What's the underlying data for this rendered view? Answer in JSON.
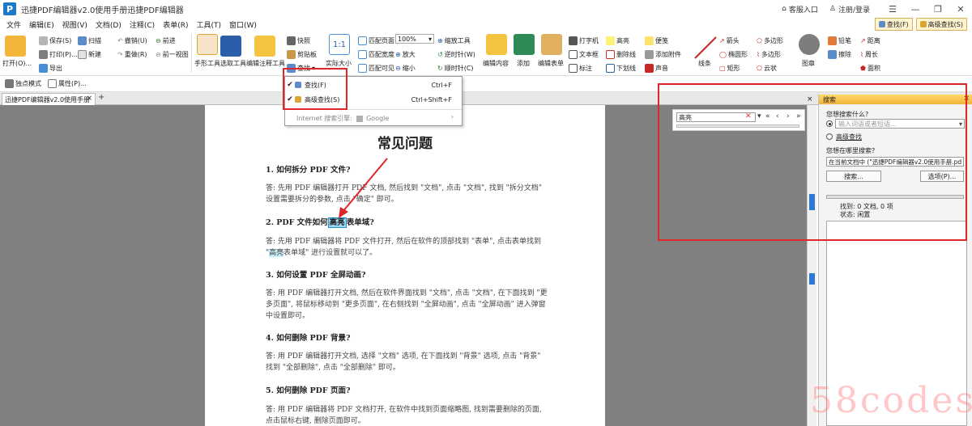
{
  "app": {
    "title": "迅捷PDF编辑器v2.0使用手册迅捷PDF编辑器",
    "logo": "P",
    "right_links": [
      {
        "icon": "home-icon",
        "label": "客服入口"
      },
      {
        "icon": "user-icon",
        "label": "注册/登录"
      }
    ],
    "window_buttons": [
      "☰",
      "—",
      "❐",
      "✕"
    ]
  },
  "menu": [
    "文件",
    "编辑(E)",
    "视图(V)",
    "文档(D)",
    "注释(C)",
    "表单(R)",
    "工具(T)",
    "窗口(W)"
  ],
  "quick_tools": [
    {
      "icon": "find-icon",
      "label": "查找(F)"
    },
    {
      "icon": "advanced-find-icon",
      "label": "高级查找(S)"
    }
  ],
  "ribbon": {
    "open": "打开(O)...",
    "save": "保存(S)",
    "print": "打印(P)...",
    "export": "导出",
    "scan": "扫描",
    "new": "新建",
    "undo": "撤销(U)",
    "redo": "重做(R)",
    "forward": "前进",
    "prev_view": "前一视图",
    "hand_tool": "手形工具",
    "select_tool": "选取工具",
    "annotation_tool": "编辑注释工具",
    "snapshot": "快照",
    "clipboard": "剪贴板",
    "find": "查找",
    "actual_size": "实际大小",
    "fit_page": "匹配页面",
    "fit_width": "匹配宽度",
    "fit_visible": "匹配可见",
    "zoom_value": "100%",
    "zoom_tool": "缩放工具",
    "zoom_in": "放大",
    "zoom_out": "缩小",
    "rotate_cw": "逆时针(W)",
    "rotate_ccw": "顺时针(C)",
    "edit_content": "编辑内容",
    "add": "添加",
    "edit_form": "编辑表单",
    "typewriter": "打字机",
    "textbox": "文本框",
    "callout": "标注",
    "highlight": "高亮",
    "strikeout": "删除线",
    "underline": "下划线",
    "sticky_note": "便笺",
    "attach_file": "添加附件",
    "sound": "声音",
    "line": "线条",
    "arrow": "箭头",
    "ellipse": "椭圆形",
    "rectangle": "矩形",
    "polygon": "多边形",
    "polyline": "多边形",
    "cloud": "云状",
    "stamp": "图章",
    "pencil": "铅笔",
    "eraser": "擦除",
    "distance": "距离",
    "perimeter": "周长",
    "area": "面积"
  },
  "toolbar2": {
    "mode": "独点模式",
    "properties": "属性(P)..."
  },
  "tab": {
    "label": "迅捷PDF编辑器v2.0使用手册",
    "close": "×",
    "add": "+"
  },
  "dropdown": {
    "items": [
      {
        "label": "查找(F)",
        "shortcut": "Ctrl+F"
      },
      {
        "label": "高级查找(S)",
        "shortcut": "Ctrl+Shift+F"
      }
    ],
    "internet_search": "Internet 搜索引擎:",
    "engine": "Google"
  },
  "find_panel": {
    "value": "高亮",
    "nav": [
      "«",
      "‹",
      "›",
      "»"
    ],
    "close": "×"
  },
  "search_panel": {
    "title": "搜索",
    "close": "×",
    "question1": "您想搜索什么?",
    "placeholder": "输入词语或者短语...",
    "advanced": "高级查找",
    "question2": "您想在哪里搜索?",
    "scope": "在当前文档中 (\"迅捷PDF编辑器v2.0使用手册.pd",
    "search_btn": "搜索...",
    "options_btn": "选项(P)...",
    "found": "找到: 0 文档, 0 项",
    "status": "状态: 闲置"
  },
  "page": {
    "title": "常见问题",
    "q1": "1.  如何拆分 PDF 文件?",
    "a1": "答: 先用 PDF 编辑器打开 PDF 文档, 然后找到 \"文档\", 点击 \"文档\", 找到 \"拆分文档\" 设置需要拆分的参数, 点击 \"确定\" 即可。",
    "q2_pre": "2.  PDF 文件如何",
    "q2_hl": "高亮",
    "q2_post": "表单域?",
    "a2_pre": "答: 先用 PDF 编辑器将 PDF 文件打开, 然后在软件的顶部找到 \"表单\", 点击表单找到 \"",
    "a2_hl": "高亮",
    "a2_post": "表单域\" 进行设置就可以了。",
    "q3": "3.  如何设置 PDF 全屏动画?",
    "a3": "答: 用 PDF 编辑器打开文档, 然后在软件界面找到 \"文档\", 点击 \"文档\", 在下面找到 \"更多页面\", 将鼠标移动到 \"更多页面\", 在右侧找到 \"全屏动画\", 点击 \"全屏动画\" 进入弹窗中设置即可。",
    "q4": "4.  如何删除 PDF 背景?",
    "a4": "答: 用 PDF 编辑器打开文档, 选择 \"文档\" 选项, 在下面找到 \"背景\" 选项, 点击 \"背景\" 找到 \"全部删除\", 点击 \"全部删除\" 即可。",
    "q5": "5.  如何删除 PDF 页面?",
    "a5": "答: 用 PDF 编辑器将 PDF 文档打开, 在软件中找到页面缩略图, 找到需要删除的页面, 点击鼠标右键, 删除页面即可。"
  },
  "watermark": "58codes",
  "colors": {
    "accent_red": "#e02626",
    "highlight": "#9fd8ef",
    "panel_title": "#f4b23a"
  }
}
